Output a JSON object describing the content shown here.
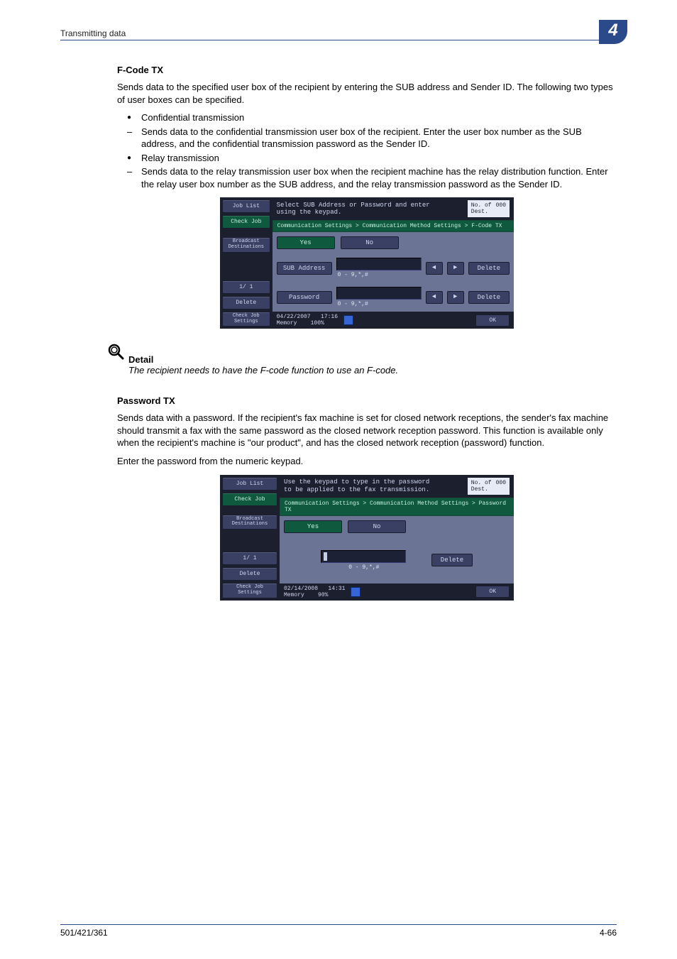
{
  "header": {
    "title": "Transmitting data",
    "chapter_number": "4"
  },
  "section1": {
    "heading": "F-Code TX",
    "intro": "Sends data to the specified user box of the recipient by entering the SUB address and Sender ID. The following two types of user boxes can be specified.",
    "items": [
      {
        "type": "dot",
        "text": "Confidential transmission"
      },
      {
        "type": "dash",
        "text": "Sends data to the confidential transmission user box of the recipient. Enter the user box number as the SUB address, and the confidential transmission password as the Sender ID."
      },
      {
        "type": "dot",
        "text": "Relay transmission"
      },
      {
        "type": "dash",
        "text": "Sends data to the relay transmission user box when the recipient machine has the relay distribution function. Enter the relay user box number as the SUB address, and the relay transmission password as the Sender ID."
      }
    ]
  },
  "screen1": {
    "side": {
      "job_list": "Job List",
      "check_job": "Check Job",
      "broadcast": "Broadcast\nDestinations",
      "page": "1/  1",
      "delete": "Delete",
      "check_settings": "Check Job\nSettings"
    },
    "instruction": "Select SUB Address or Password and enter\nusing the keypad.",
    "dest_label": "No. of\nDest.",
    "dest_count": "000",
    "breadcrumb": "Communication Settings > Communication Method Settings > F-Code TX",
    "yes": "Yes",
    "no": "No",
    "field1_label": "SUB Address",
    "field2_label": "Password",
    "range": "0 - 9,*,#",
    "delete_btn": "Delete",
    "status_date": "04/22/2007",
    "status_time": "17:16",
    "memory_label": "Memory",
    "memory_value": "100%",
    "ok": "OK"
  },
  "detail": {
    "heading": "Detail",
    "text": "The recipient needs to have the F-code function to use an F-code."
  },
  "section2": {
    "heading": "Password TX",
    "p1": "Sends data with a password. If the recipient's fax machine is set for closed network receptions, the sender's fax machine should transmit a fax with the same password as the closed network reception password. This function is available only when the recipient's machine is \"our product\", and has the closed network reception (password) function.",
    "p2": "Enter the password from the numeric keypad."
  },
  "screen2": {
    "side": {
      "job_list": "Job List",
      "check_job": "Check Job",
      "broadcast": "Broadcast\nDestinations",
      "page": "1/  1",
      "delete": "Delete",
      "check_settings": "Check Job\nSettings"
    },
    "instruction": "Use the keypad to type in the password\nto be applied to the fax transmission.",
    "dest_label": "No. of\nDest.",
    "dest_count": "000",
    "breadcrumb": "Communication Settings > Communication Method Settings > Password TX",
    "yes": "Yes",
    "no": "No",
    "range": "0 - 9,*,#",
    "delete_btn": "Delete",
    "status_date": "02/14/2008",
    "status_time": "14:31",
    "memory_label": "Memory",
    "memory_value": "90%",
    "ok": "OK"
  },
  "footer": {
    "left": "501/421/361",
    "right": "4-66"
  }
}
